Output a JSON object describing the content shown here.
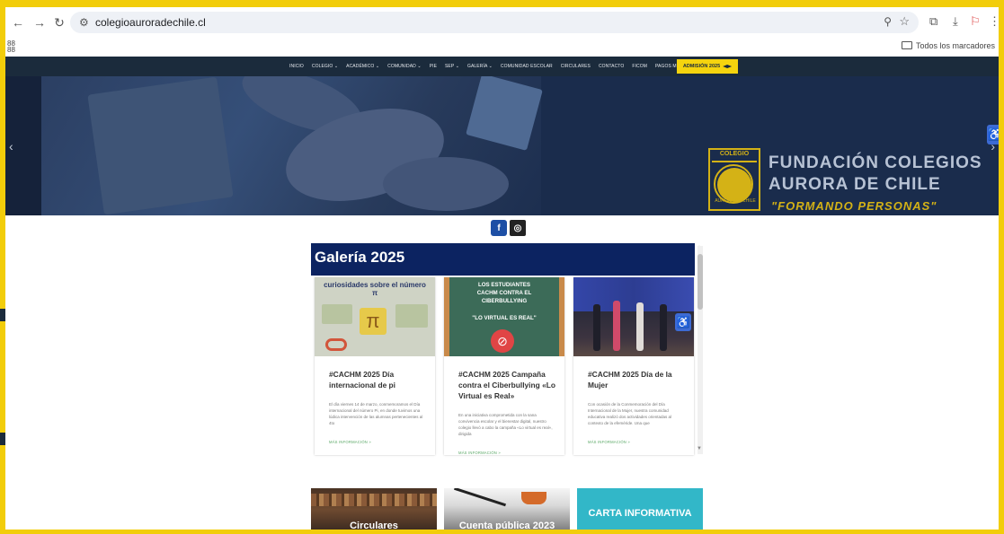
{
  "browser": {
    "url": "colegioauroradechile.cl",
    "bookmarks_folder": "Todos los marcadores",
    "left_glyph": "88\n88"
  },
  "nav": {
    "items": [
      "INICIO",
      "COLEGIO ⌄",
      "ACADÉMICO ⌄",
      "COMUNIDAD ⌄",
      "PIE",
      "SEP ⌄",
      "GALERÍA ⌄",
      "COMUNIDAD ESCOLAR",
      "CIRCULARES",
      "CONTACTO",
      "FICOM",
      "PAGOS MENSUALIDADES"
    ],
    "admission": "ADMISIÓN 2025"
  },
  "hero": {
    "emblem_label": "COLEGIO",
    "emblem_arc": "AURORA DE CHILE",
    "brand_line1": "FUNDACIÓN COLEGIOS",
    "brand_line2": "AURORA DE CHILE",
    "tagline": "\"FORMANDO PERSONAS\""
  },
  "gallery": {
    "title": "Galería 2025",
    "cards": [
      {
        "image_caption": "curiosidades sobre el número π",
        "title": "#CACHM 2025 Día internacional de pi",
        "excerpt": "El día viernes 14 de marzo, conmemoramos el Día internacional del número Pi, en donde tuvimos una lúdica intervención de las alumnas pertenecientes al 4to",
        "more": "MÁS INFORMACIÓN »"
      },
      {
        "image_caption": "LOS ESTUDIANTES CACHM CONTRA EL CIBERBULLYING",
        "image_quote": "\"LO VIRTUAL ES REAL\"",
        "title": "#CACHM 2025 Campaña contra el Ciberbullying «Lo Virtual es Real»",
        "excerpt": "En una iniciativa comprometida con la sana convivencia escolar y el bienestar digital, nuestro colegio llevó a cabo la campaña «Lo virtual es real», dirigida",
        "more": "MÁS INFORMACIÓN »"
      },
      {
        "title": "#CACHM 2025 Día de la Mujer",
        "excerpt": "Con ocasión de la Conmemoración del Día Internacional de la Mujer, nuestra comunidad educativa realizó dos actividades orientadas al contexto de la efeméride. Una que",
        "more": "MÁS INFORMACIÓN »"
      }
    ]
  },
  "bottom_cards": [
    {
      "label": "Circulares"
    },
    {
      "label": "Cuenta pública 2023"
    },
    {
      "label": "CARTA INFORMATIVA"
    }
  ],
  "colors": {
    "frame": "#f2cd0a",
    "nav_bg": "#1b2b3c",
    "gallery_header": "#0c2361",
    "accent_yellow": "#f5d40e",
    "link_green": "#5aa866"
  }
}
